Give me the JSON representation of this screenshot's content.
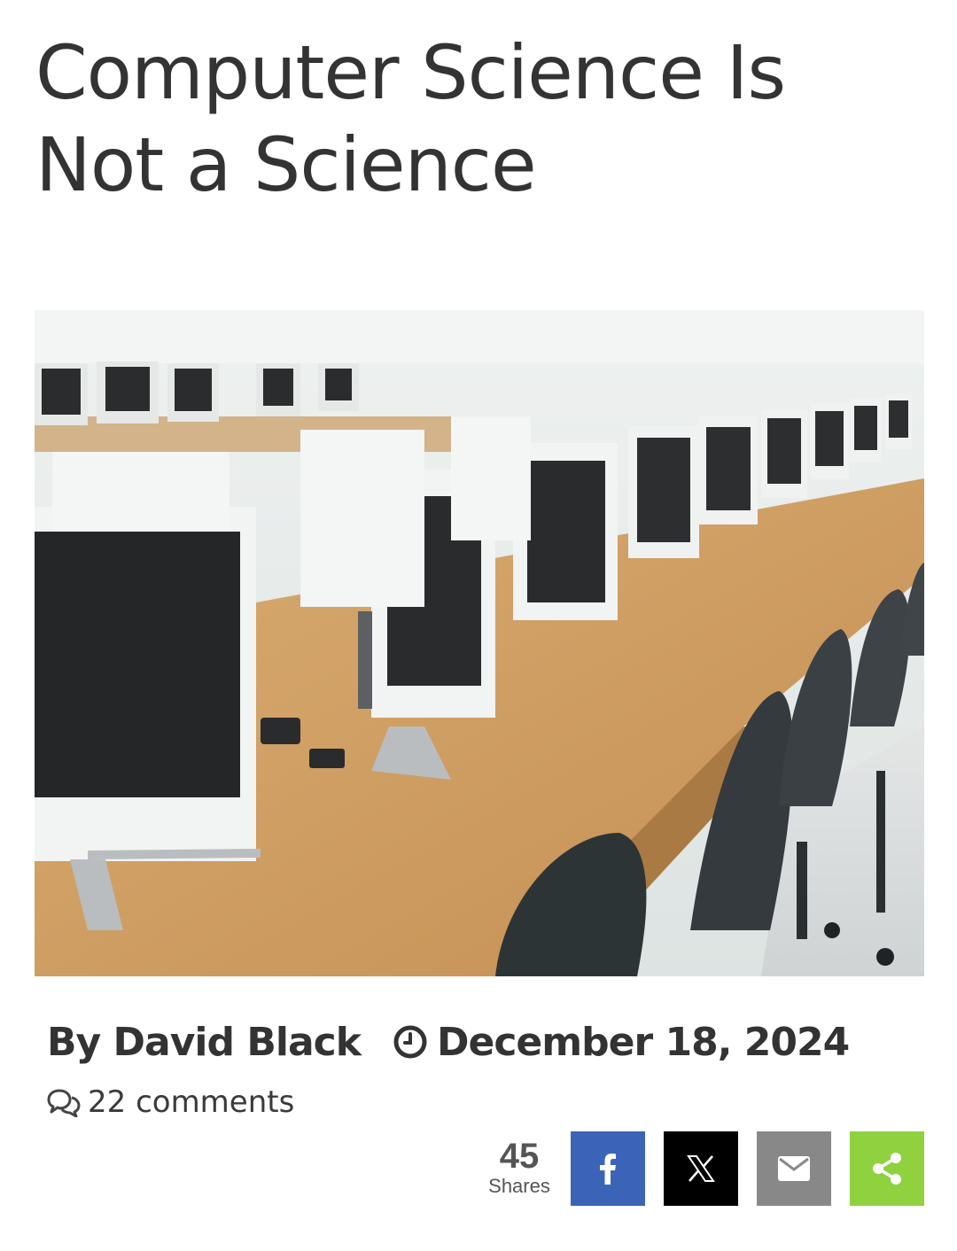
{
  "article": {
    "title": "Computer Science Is Not a Science",
    "hero_image": "computer-lab-photo",
    "byline": "By David Black",
    "date": "December 18, 2024",
    "comments": "22 comments"
  },
  "share": {
    "count": "45",
    "count_label": "Shares",
    "buttons": [
      {
        "name": "facebook",
        "icon": "facebook-icon",
        "color": "#3b64b8"
      },
      {
        "name": "x",
        "icon": "x-icon",
        "color": "#000000"
      },
      {
        "name": "email",
        "icon": "email-icon",
        "color": "#888888"
      },
      {
        "name": "share",
        "icon": "share-icon",
        "color": "#8fd13f"
      }
    ]
  },
  "colors": {
    "text": "#333333",
    "muted": "#555555"
  }
}
